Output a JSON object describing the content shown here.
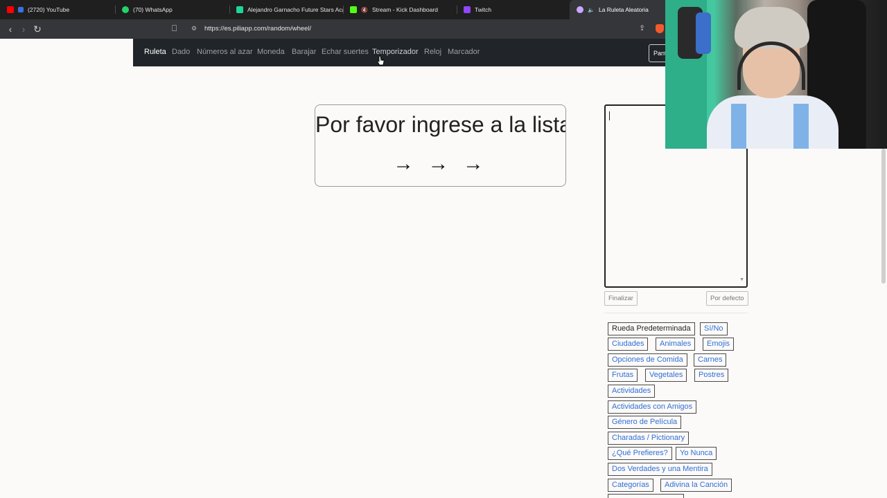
{
  "browser": {
    "tabs": [
      {
        "title": "(2720) YouTube",
        "icon": "youtube-icon",
        "color": "#ff0000"
      },
      {
        "title": "(70) WhatsApp",
        "icon": "whatsapp-icon",
        "color": "#25d366"
      },
      {
        "title": "Alejandro Garnacho Future Stars Aca",
        "icon": "futbin-icon",
        "color": "#1fd49b"
      },
      {
        "title": "Stream - Kick Dashboard",
        "icon": "kick-icon",
        "color": "#53fc18"
      },
      {
        "title": "Twitch",
        "icon": "twitch-icon",
        "color": "#9146ff"
      },
      {
        "title": "La Ruleta Aleatoria",
        "icon": "piliapp-icon",
        "color": "#c8a8ff"
      }
    ],
    "url": "https://es.piliapp.com/random/wheel/"
  },
  "nav": {
    "items": [
      "Ruleta",
      "Dado",
      "Números al azar",
      "Moneda",
      "Barajar",
      "Echar suertes",
      "Temporizador",
      "Reloj",
      "Marcador"
    ],
    "fullscreen_label": "Pantalla completa"
  },
  "wheel": {
    "message": "Por favor ingrese a la lista",
    "arrows": "→ → →"
  },
  "list_editor": {
    "text": "",
    "finish_label": "Finalizar",
    "default_label": "Por defecto"
  },
  "presets": [
    "Rueda Predeterminada",
    "Sí/No",
    "Ciudades",
    "Animales",
    "Emojis",
    "Opciones de Comida",
    "Carnes",
    "Frutas",
    "Vegetales",
    "Postres",
    "Actividades",
    "Actividades con Amigos",
    "Género de Película",
    "Charadas / Pictionary",
    "¿Qué Prefieres?",
    "Yo Nunca",
    "Dos Verdades y una Mentira",
    "Categorías",
    "Adivina la Canción"
  ]
}
